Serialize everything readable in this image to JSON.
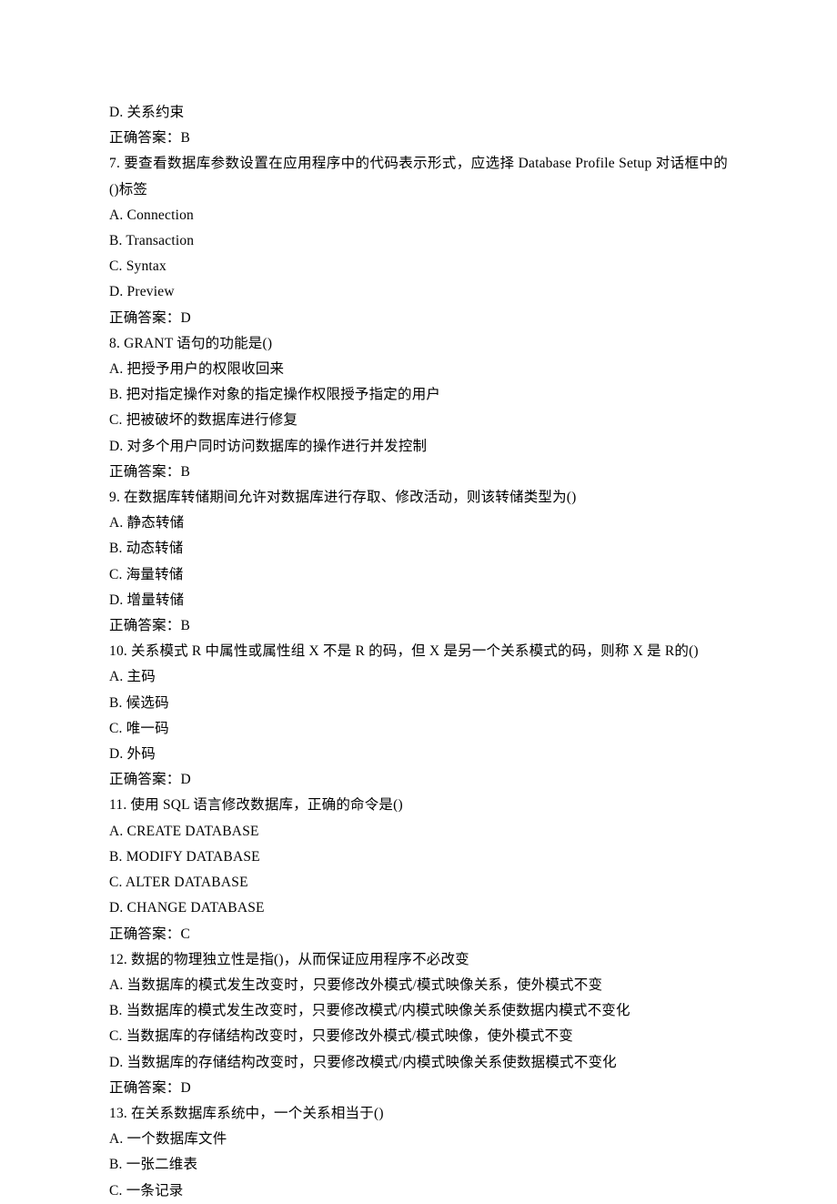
{
  "lines": [
    "D. 关系约束",
    "正确答案：B",
    "7.   要查看数据库参数设置在应用程序中的代码表示形式，应选择 Database Profile Setup 对话框中的()标签",
    "A. Connection",
    "B. Transaction",
    "C. Syntax",
    "D. Preview",
    "正确答案：D",
    "8.   GRANT 语句的功能是()",
    "A. 把授予用户的权限收回来",
    "B. 把对指定操作对象的指定操作权限授予指定的用户",
    "C. 把被破坏的数据库进行修复",
    "D. 对多个用户同时访问数据库的操作进行并发控制",
    "正确答案：B",
    "9.   在数据库转储期间允许对数据库进行存取、修改活动，则该转储类型为()",
    "A. 静态转储",
    "B. 动态转储",
    "C. 海量转储",
    "D. 增量转储",
    "正确答案：B",
    "10.   关系模式 R 中属性或属性组 X 不是 R 的码，但 X 是另一个关系模式的码，则称 X 是 R的()",
    "A. 主码",
    "B. 候选码",
    "C. 唯一码",
    "D. 外码",
    "正确答案：D",
    "11.   使用 SQL 语言修改数据库，正确的命令是()",
    "A. CREATE DATABASE",
    "B. MODIFY DATABASE",
    "C. ALTER DATABASE",
    "D. CHANGE DATABASE",
    "正确答案：C",
    "12.   数据的物理独立性是指()，从而保证应用程序不必改变",
    "A. 当数据库的模式发生改变时，只要修改外模式/模式映像关系，使外模式不变",
    "B. 当数据库的模式发生改变时，只要修改模式/内模式映像关系使数据内模式不变化",
    "C. 当数据库的存储结构改变时，只要修改外模式/模式映像，使外模式不变",
    "D. 当数据库的存储结构改变时，只要修改模式/内模式映像关系使数据模式不变化",
    "正确答案：D",
    "13.   在关系数据库系统中，一个关系相当于()",
    "A. 一个数据库文件",
    "B. 一张二维表",
    "C. 一条记录"
  ]
}
